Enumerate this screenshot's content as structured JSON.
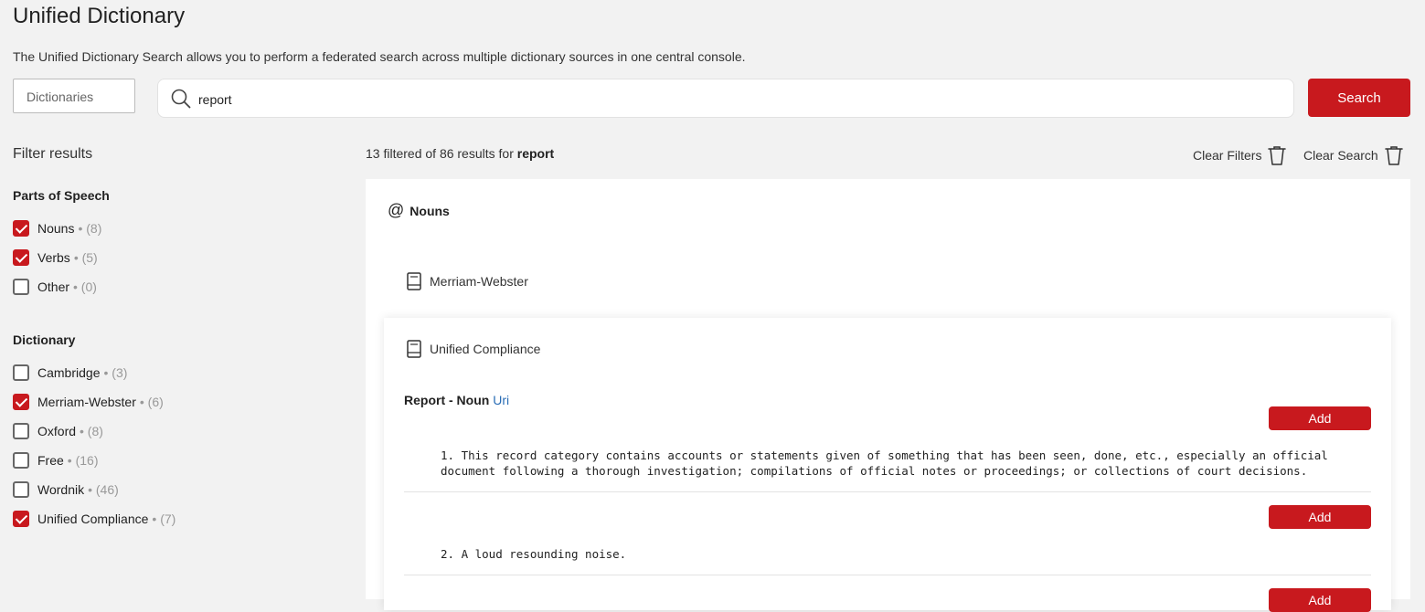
{
  "page": {
    "title": "Unified Dictionary",
    "description": "The Unified Dictionary Search allows you to perform a federated search across multiple dictionary sources in one central console."
  },
  "search": {
    "dictionaries_placeholder": "Dictionaries",
    "query": "report",
    "button_label": "Search"
  },
  "filters": {
    "title": "Filter results",
    "parts_of_speech": {
      "title": "Parts of Speech",
      "items": [
        {
          "label": "Nouns",
          "count": "• (8)",
          "checked": true
        },
        {
          "label": "Verbs",
          "count": "• (5)",
          "checked": true
        },
        {
          "label": "Other",
          "count": "• (0)",
          "checked": false
        }
      ]
    },
    "dictionary": {
      "title": "Dictionary",
      "items": [
        {
          "label": "Cambridge",
          "count": "• (3)",
          "checked": false
        },
        {
          "label": "Merriam-Webster",
          "count": "• (6)",
          "checked": true
        },
        {
          "label": "Oxford",
          "count": "• (8)",
          "checked": false
        },
        {
          "label": "Free",
          "count": "• (16)",
          "checked": false
        },
        {
          "label": "Wordnik",
          "count": "• (46)",
          "checked": false
        },
        {
          "label": "Unified Compliance",
          "count": "• (7)",
          "checked": true
        }
      ]
    }
  },
  "results": {
    "summary_prefix": "13 filtered of 86 results for",
    "summary_term": "report",
    "clear_filters_label": "Clear Filters",
    "clear_search_label": "Clear Search",
    "section_title": "Nouns",
    "section_icon": "at-icon",
    "dictionary_1": "Merriam-Webster",
    "dictionary_2": "Unified Compliance",
    "term_label": "Report - Noun",
    "term_link": "Uri",
    "add_label": "Add",
    "definitions": [
      "1. This record category contains accounts or statements given of something that has been seen, done, etc., especially an official document following a thorough investigation; compilations of official notes or proceedings; or collections of court decisions.",
      "2. A loud resounding noise."
    ]
  },
  "colors": {
    "accent": "#c8191e",
    "link": "#2a6db5",
    "background": "#f2f2f2"
  }
}
